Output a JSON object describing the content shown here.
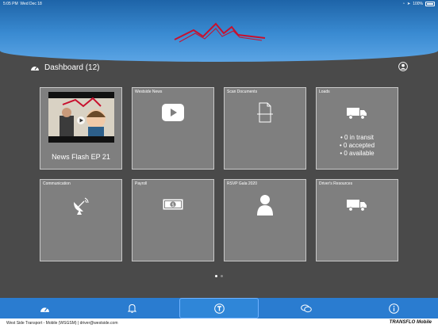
{
  "status": {
    "time": "5:05 PM",
    "date": "Wed Dec 18",
    "battery": "100%"
  },
  "header": {
    "brand_color": "#c8102e"
  },
  "dashboard": {
    "title": "Dashboard (12)"
  },
  "tiles": [
    {
      "label": "",
      "title": "News Flash EP 21",
      "icon": "video-thumbnail"
    },
    {
      "label": "Westside News",
      "icon": "play-icon"
    },
    {
      "label": "Scan Documents",
      "icon": "document-icon"
    },
    {
      "label": "Loads",
      "icon": "truck-icon",
      "lines": [
        "• 0 in transit",
        "• 0 accepted",
        "• 0 available"
      ]
    },
    {
      "label": "Communication",
      "icon": "satellite-dish-icon"
    },
    {
      "label": "Payroll",
      "icon": "money-icon"
    },
    {
      "label": "RSVP Gala 2020",
      "icon": "person-icon"
    },
    {
      "label": "Driver's Resources",
      "icon": "truck-icon"
    }
  ],
  "pager": {
    "pages": 2,
    "current": 1
  },
  "tabbar": {
    "tabs": [
      "dashboard-icon",
      "bell-icon",
      "transflo-icon",
      "chat-icon",
      "info-icon"
    ],
    "active": 2
  },
  "footer": {
    "info": "West Side Transport - Mobile (WSGSM)   |   driver@westside.com",
    "brand": "TRANSFLO Mobile"
  }
}
